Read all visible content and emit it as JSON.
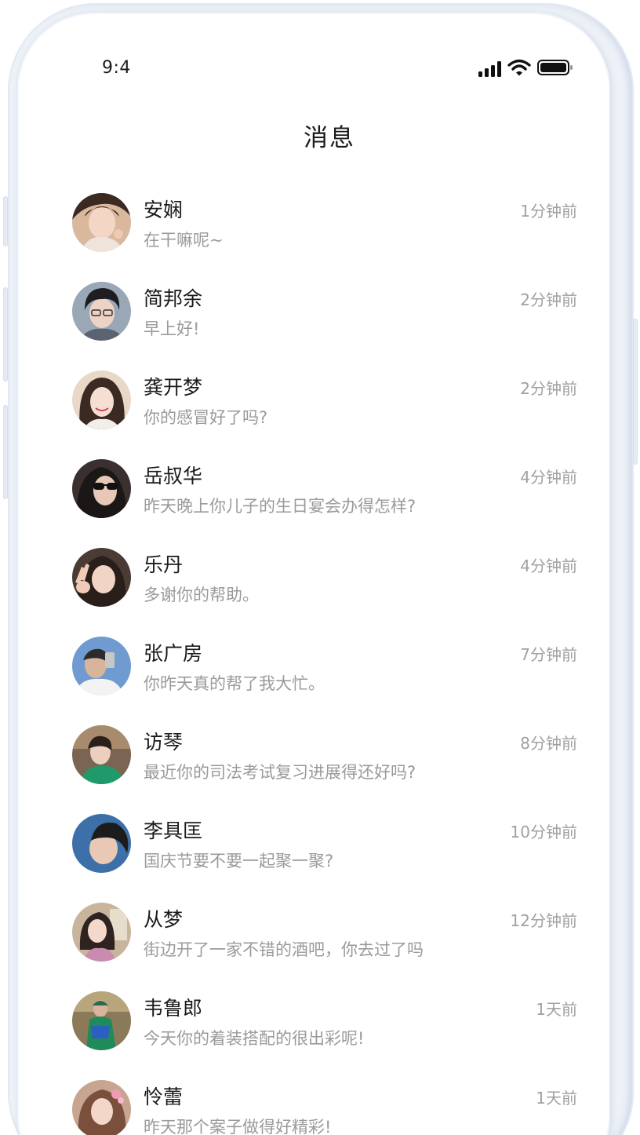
{
  "status_bar": {
    "time": "9:4",
    "icons": [
      "signal-icon",
      "wifi-icon",
      "battery-icon"
    ]
  },
  "header": {
    "title": "消息"
  },
  "colors": {
    "name": "#1a1a1a",
    "preview": "#9a9a9a",
    "time": "#a0a0a0",
    "frame": "#eef2f8"
  },
  "messages": [
    {
      "name": "安娴",
      "preview": "在干嘛呢~",
      "time": "1分钟前",
      "avatar": "avatar-girl-peace-sign"
    },
    {
      "name": "简邦余",
      "preview": "早上好!",
      "time": "2分钟前",
      "avatar": "avatar-boy-glasses"
    },
    {
      "name": "龚开梦",
      "preview": "你的感冒好了吗?",
      "time": "2分钟前",
      "avatar": "avatar-girl-smile"
    },
    {
      "name": "岳叔华",
      "preview": "昨天晚上你儿子的生日宴会办得怎样?",
      "time": "4分钟前",
      "avatar": "avatar-sunglasses-hood"
    },
    {
      "name": "乐丹",
      "preview": "多谢你的帮助。",
      "time": "4分钟前",
      "avatar": "avatar-girl-peace-sign-2"
    },
    {
      "name": "张广房",
      "preview": "你昨天真的帮了我大忙。",
      "time": "7分钟前",
      "avatar": "avatar-selfie-sky"
    },
    {
      "name": "访琴",
      "preview": "最近你的司法考试复习进展得还好吗?",
      "time": "8分钟前",
      "avatar": "avatar-girl-green-jacket"
    },
    {
      "name": "李具匡",
      "preview": "国庆节要不要一起聚一聚?",
      "time": "10分钟前",
      "avatar": "avatar-boy-blue-sky"
    },
    {
      "name": "从梦",
      "preview": "街边开了一家不错的酒吧，你去过了吗",
      "time": "12分钟前",
      "avatar": "avatar-girl-cafe"
    },
    {
      "name": "韦鲁郎",
      "preview": "今天你的着装搭配的很出彩呢!",
      "time": "1天前",
      "avatar": "avatar-green-coat-outdoor"
    },
    {
      "name": "怜蕾",
      "preview": "昨天那个案子做得好精彩!",
      "time": "1天前",
      "avatar": "avatar-girl-pink"
    }
  ]
}
